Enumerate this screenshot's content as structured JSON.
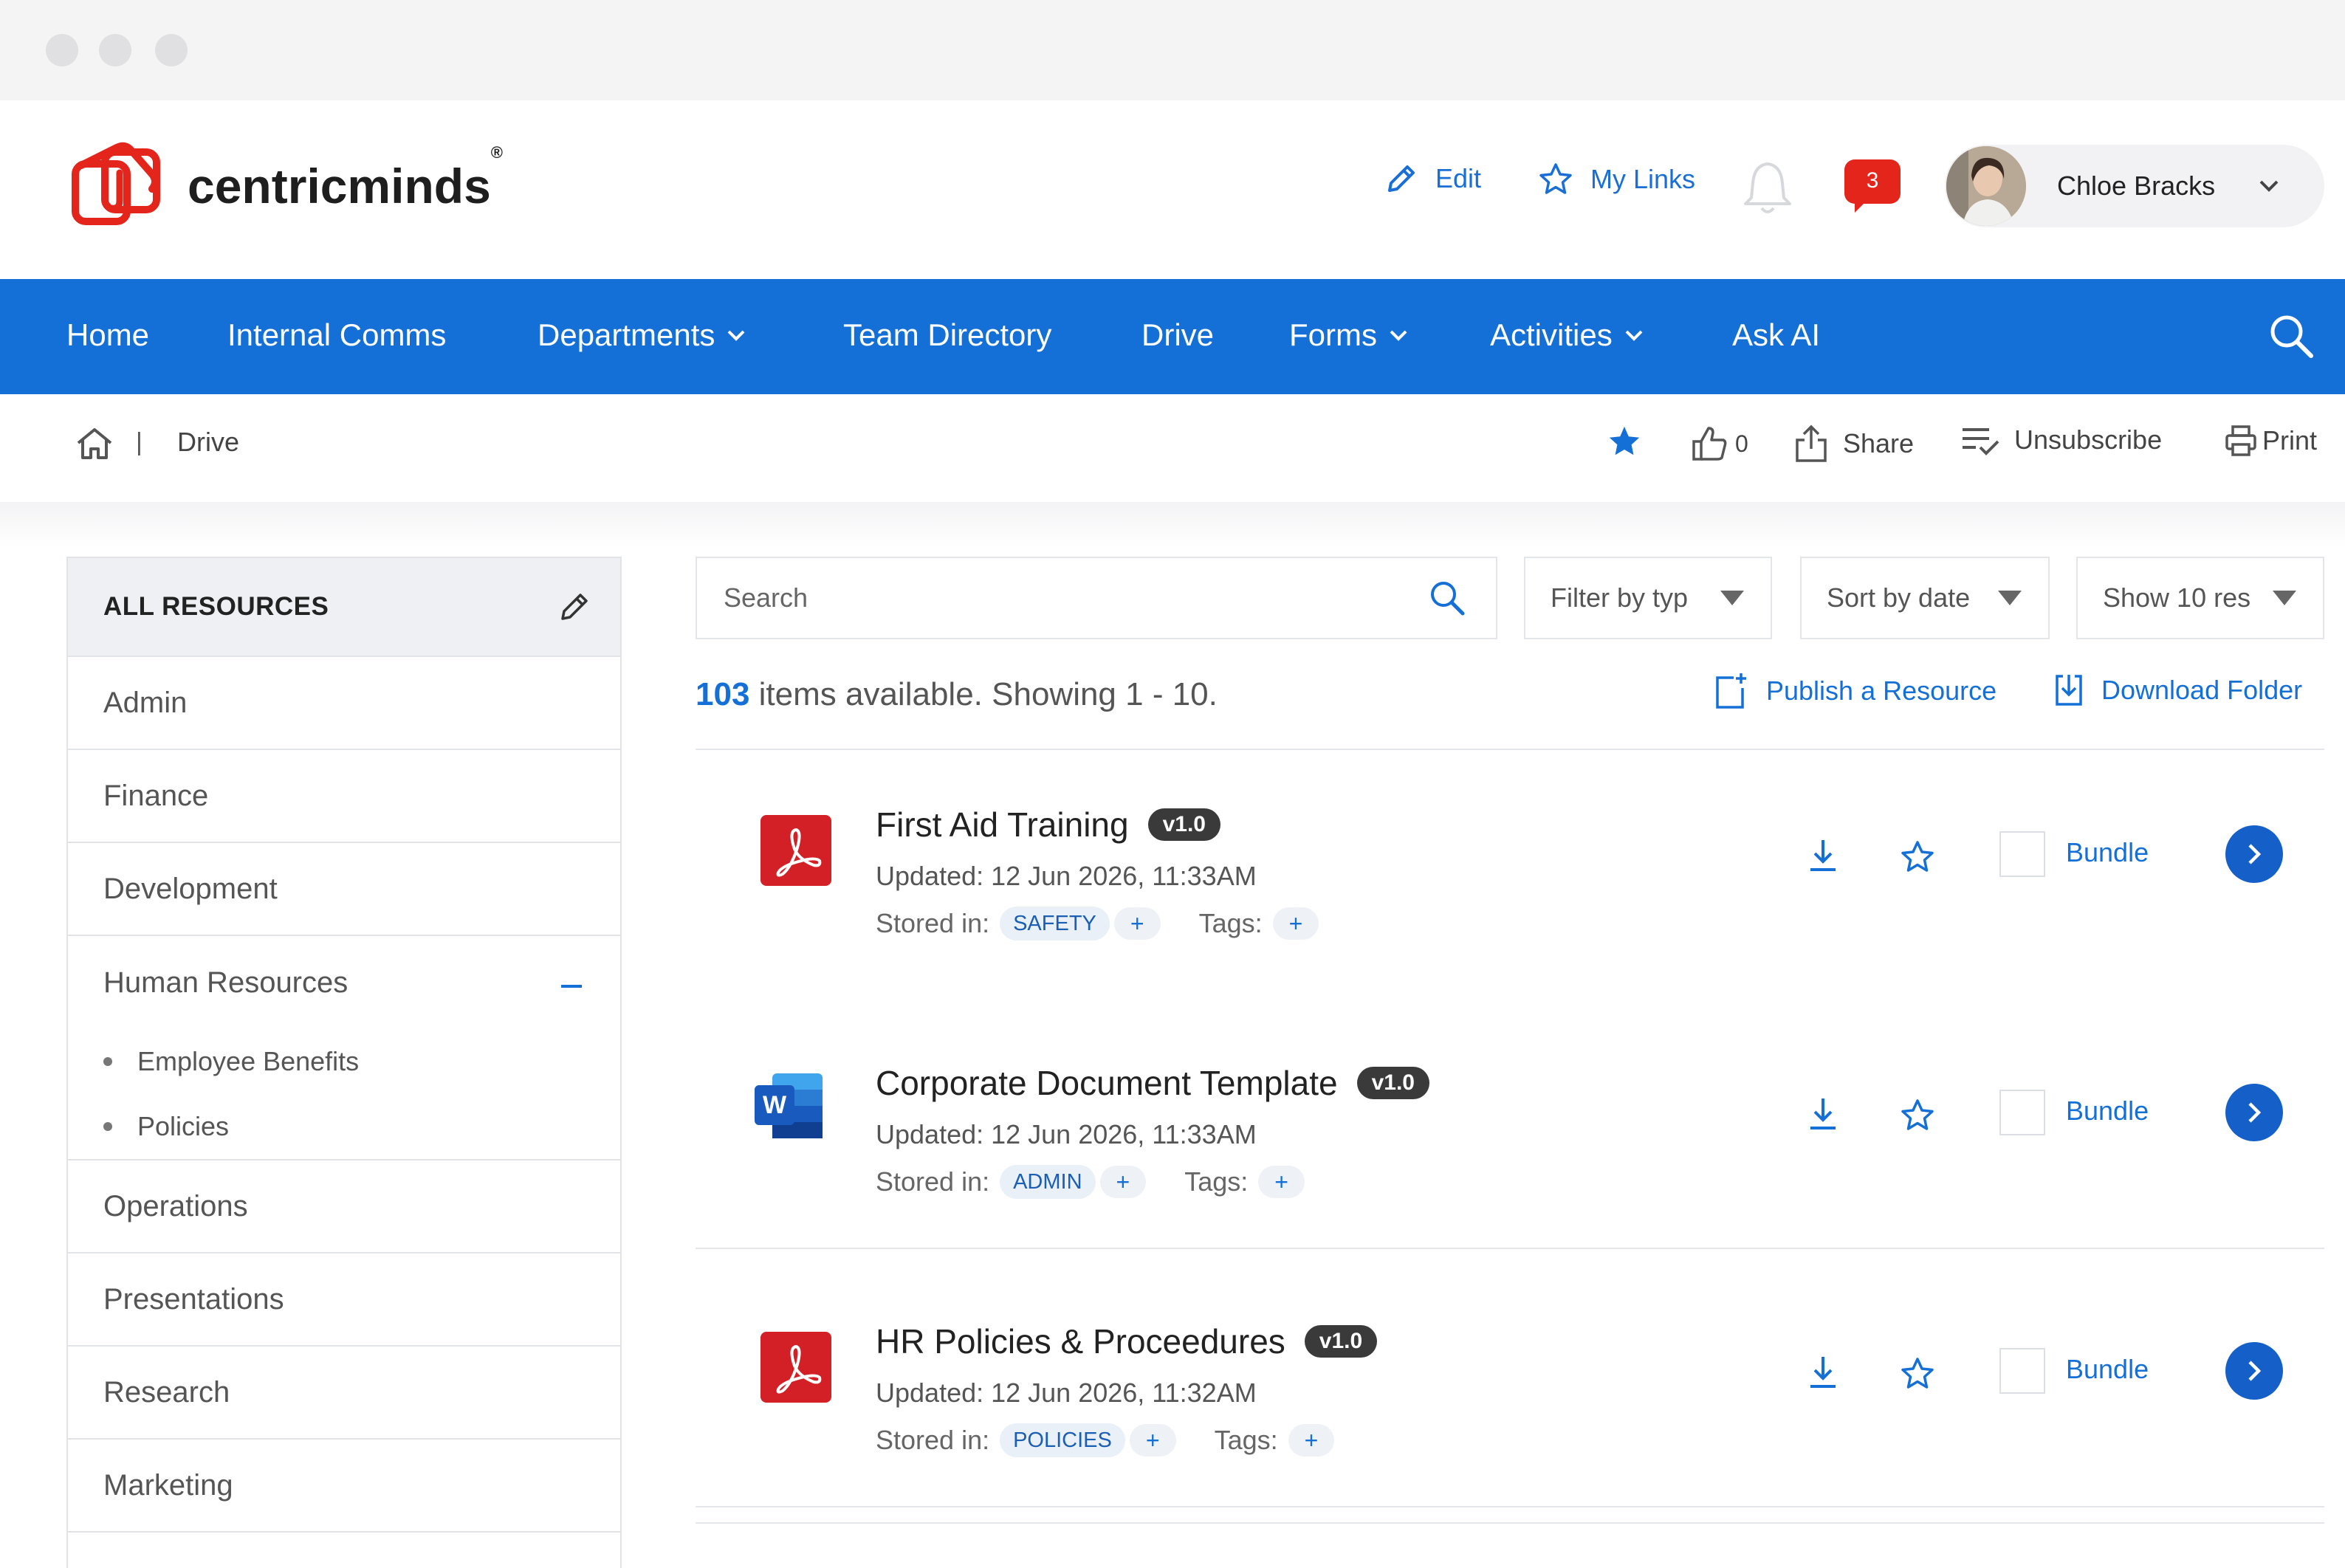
{
  "header": {
    "logo_text": "centricminds",
    "logo_reg": "®",
    "edit_label": "Edit",
    "mylinks_label": "My Links",
    "chat_count": "3",
    "user_name": "Chloe Bracks"
  },
  "nav": {
    "items": [
      {
        "label": "Home"
      },
      {
        "label": "Internal Comms"
      },
      {
        "label": "Departments"
      },
      {
        "label": "Team Directory"
      },
      {
        "label": "Drive"
      },
      {
        "label": "Forms"
      },
      {
        "label": "Activities"
      },
      {
        "label": "Ask AI"
      }
    ]
  },
  "breadcrumb": {
    "separator": "|",
    "current": "Drive"
  },
  "actions": {
    "like_count": "0",
    "share": "Share",
    "unsubscribe": "Unsubscribe",
    "print": "Print"
  },
  "sidebar": {
    "title": "ALL RESOURCES",
    "items": [
      {
        "label": "Admin"
      },
      {
        "label": "Finance"
      },
      {
        "label": "Development"
      },
      {
        "label": "Human Resources"
      },
      {
        "label": "Operations"
      },
      {
        "label": "Presentations"
      },
      {
        "label": "Research"
      },
      {
        "label": "Marketing"
      }
    ],
    "hr_children": [
      {
        "label": "Employee Benefits"
      },
      {
        "label": "Policies"
      }
    ]
  },
  "toolbar": {
    "search_placeholder": "Search",
    "filter": "Filter by typ",
    "sort": "Sort by date",
    "show": "Show 10 res",
    "count": "103",
    "summary_rest": " items available. Showing 1 - 10.",
    "publish": "Publish a Resource",
    "download_folder": "Download Folder"
  },
  "resources": [
    {
      "title": "First Aid Training",
      "version": "v1.0",
      "updated": "Updated: 12 Jun 2026, 11:33AM",
      "stored_label": "Stored in:",
      "stored_tag": "SAFETY",
      "plus": "+",
      "tags_label": "Tags:",
      "bundle": "Bundle",
      "file_type": "pdf"
    },
    {
      "title": "Corporate Document Template",
      "version": "v1.0",
      "updated": "Updated: 12 Jun 2026, 11:33AM",
      "stored_label": "Stored in:",
      "stored_tag": "ADMIN",
      "plus": "+",
      "tags_label": "Tags:",
      "bundle": "Bundle",
      "file_type": "word"
    },
    {
      "title": "HR Policies & Proceedures",
      "version": "v1.0",
      "updated": "Updated: 12 Jun 2026, 11:32AM",
      "stored_label": "Stored in:",
      "stored_tag": "POLICIES",
      "plus": "+",
      "tags_label": "Tags:",
      "bundle": "Bundle",
      "file_type": "pdf"
    }
  ],
  "colors": {
    "brand_blue": "#1470d6",
    "logo_red": "#e4251b",
    "pdf_red": "#d32027",
    "word_blue": "#185abd"
  }
}
